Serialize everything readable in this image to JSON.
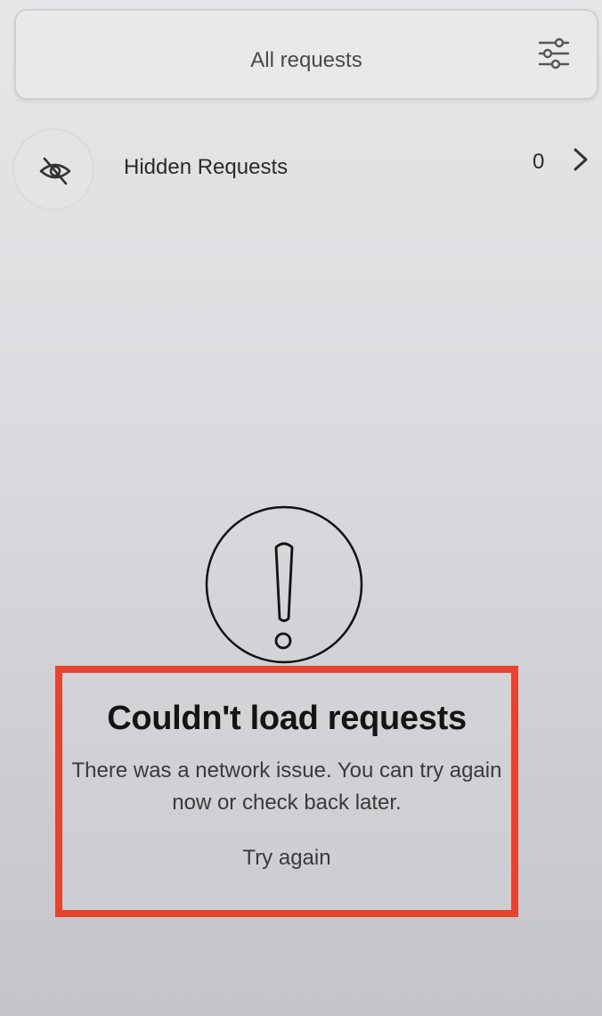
{
  "filter": {
    "label": "All requests",
    "icon": "sliders-icon"
  },
  "hidden_requests": {
    "icon": "eye-off-icon",
    "label": "Hidden Requests",
    "count": "0"
  },
  "error": {
    "icon": "exclamation-circle-icon",
    "title": "Couldn't load requests",
    "message": "There was a network issue. You can try again now or check back later.",
    "retry_label": "Try again"
  },
  "colors": {
    "highlight": "#e8432d",
    "text": "#141414"
  }
}
